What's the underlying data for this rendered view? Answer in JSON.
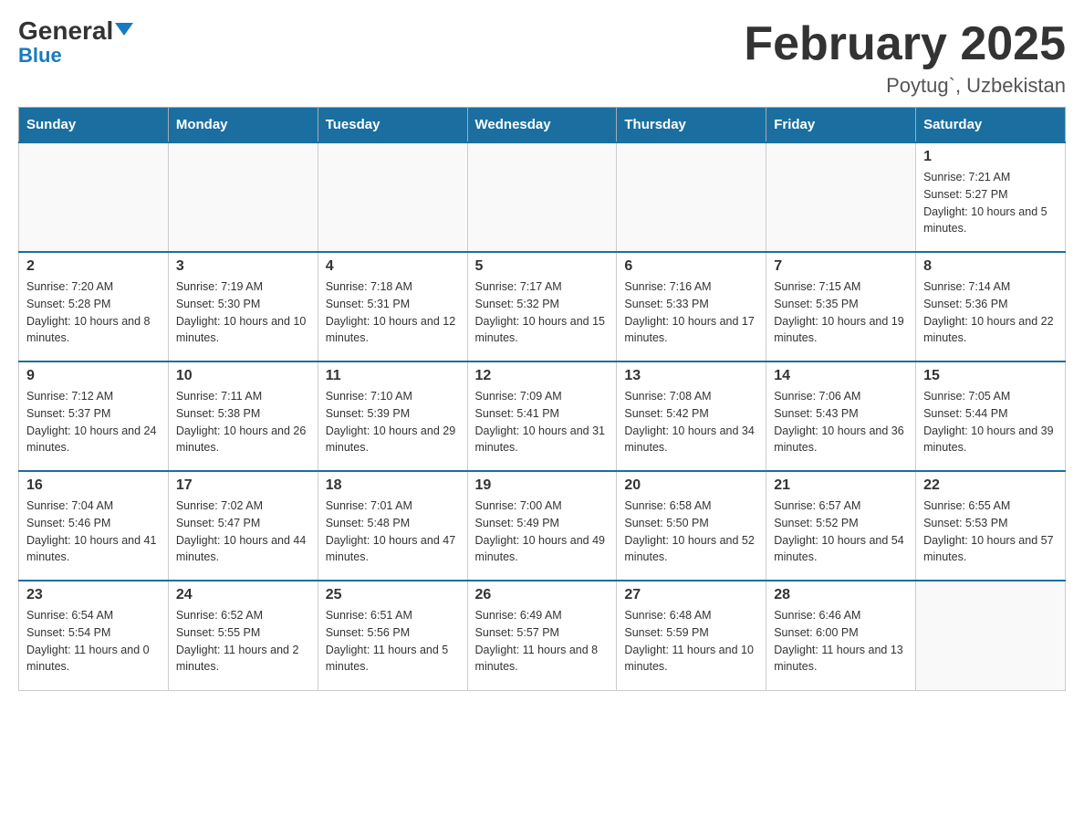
{
  "logo": {
    "general": "General",
    "blue": "Blue"
  },
  "title": "February 2025",
  "subtitle": "Poytug`, Uzbekistan",
  "days_of_week": [
    "Sunday",
    "Monday",
    "Tuesday",
    "Wednesday",
    "Thursday",
    "Friday",
    "Saturday"
  ],
  "weeks": [
    [
      {
        "day": "",
        "info": ""
      },
      {
        "day": "",
        "info": ""
      },
      {
        "day": "",
        "info": ""
      },
      {
        "day": "",
        "info": ""
      },
      {
        "day": "",
        "info": ""
      },
      {
        "day": "",
        "info": ""
      },
      {
        "day": "1",
        "info": "Sunrise: 7:21 AM\nSunset: 5:27 PM\nDaylight: 10 hours and 5 minutes."
      }
    ],
    [
      {
        "day": "2",
        "info": "Sunrise: 7:20 AM\nSunset: 5:28 PM\nDaylight: 10 hours and 8 minutes."
      },
      {
        "day": "3",
        "info": "Sunrise: 7:19 AM\nSunset: 5:30 PM\nDaylight: 10 hours and 10 minutes."
      },
      {
        "day": "4",
        "info": "Sunrise: 7:18 AM\nSunset: 5:31 PM\nDaylight: 10 hours and 12 minutes."
      },
      {
        "day": "5",
        "info": "Sunrise: 7:17 AM\nSunset: 5:32 PM\nDaylight: 10 hours and 15 minutes."
      },
      {
        "day": "6",
        "info": "Sunrise: 7:16 AM\nSunset: 5:33 PM\nDaylight: 10 hours and 17 minutes."
      },
      {
        "day": "7",
        "info": "Sunrise: 7:15 AM\nSunset: 5:35 PM\nDaylight: 10 hours and 19 minutes."
      },
      {
        "day": "8",
        "info": "Sunrise: 7:14 AM\nSunset: 5:36 PM\nDaylight: 10 hours and 22 minutes."
      }
    ],
    [
      {
        "day": "9",
        "info": "Sunrise: 7:12 AM\nSunset: 5:37 PM\nDaylight: 10 hours and 24 minutes."
      },
      {
        "day": "10",
        "info": "Sunrise: 7:11 AM\nSunset: 5:38 PM\nDaylight: 10 hours and 26 minutes."
      },
      {
        "day": "11",
        "info": "Sunrise: 7:10 AM\nSunset: 5:39 PM\nDaylight: 10 hours and 29 minutes."
      },
      {
        "day": "12",
        "info": "Sunrise: 7:09 AM\nSunset: 5:41 PM\nDaylight: 10 hours and 31 minutes."
      },
      {
        "day": "13",
        "info": "Sunrise: 7:08 AM\nSunset: 5:42 PM\nDaylight: 10 hours and 34 minutes."
      },
      {
        "day": "14",
        "info": "Sunrise: 7:06 AM\nSunset: 5:43 PM\nDaylight: 10 hours and 36 minutes."
      },
      {
        "day": "15",
        "info": "Sunrise: 7:05 AM\nSunset: 5:44 PM\nDaylight: 10 hours and 39 minutes."
      }
    ],
    [
      {
        "day": "16",
        "info": "Sunrise: 7:04 AM\nSunset: 5:46 PM\nDaylight: 10 hours and 41 minutes."
      },
      {
        "day": "17",
        "info": "Sunrise: 7:02 AM\nSunset: 5:47 PM\nDaylight: 10 hours and 44 minutes."
      },
      {
        "day": "18",
        "info": "Sunrise: 7:01 AM\nSunset: 5:48 PM\nDaylight: 10 hours and 47 minutes."
      },
      {
        "day": "19",
        "info": "Sunrise: 7:00 AM\nSunset: 5:49 PM\nDaylight: 10 hours and 49 minutes."
      },
      {
        "day": "20",
        "info": "Sunrise: 6:58 AM\nSunset: 5:50 PM\nDaylight: 10 hours and 52 minutes."
      },
      {
        "day": "21",
        "info": "Sunrise: 6:57 AM\nSunset: 5:52 PM\nDaylight: 10 hours and 54 minutes."
      },
      {
        "day": "22",
        "info": "Sunrise: 6:55 AM\nSunset: 5:53 PM\nDaylight: 10 hours and 57 minutes."
      }
    ],
    [
      {
        "day": "23",
        "info": "Sunrise: 6:54 AM\nSunset: 5:54 PM\nDaylight: 11 hours and 0 minutes."
      },
      {
        "day": "24",
        "info": "Sunrise: 6:52 AM\nSunset: 5:55 PM\nDaylight: 11 hours and 2 minutes."
      },
      {
        "day": "25",
        "info": "Sunrise: 6:51 AM\nSunset: 5:56 PM\nDaylight: 11 hours and 5 minutes."
      },
      {
        "day": "26",
        "info": "Sunrise: 6:49 AM\nSunset: 5:57 PM\nDaylight: 11 hours and 8 minutes."
      },
      {
        "day": "27",
        "info": "Sunrise: 6:48 AM\nSunset: 5:59 PM\nDaylight: 11 hours and 10 minutes."
      },
      {
        "day": "28",
        "info": "Sunrise: 6:46 AM\nSunset: 6:00 PM\nDaylight: 11 hours and 13 minutes."
      },
      {
        "day": "",
        "info": ""
      }
    ]
  ]
}
